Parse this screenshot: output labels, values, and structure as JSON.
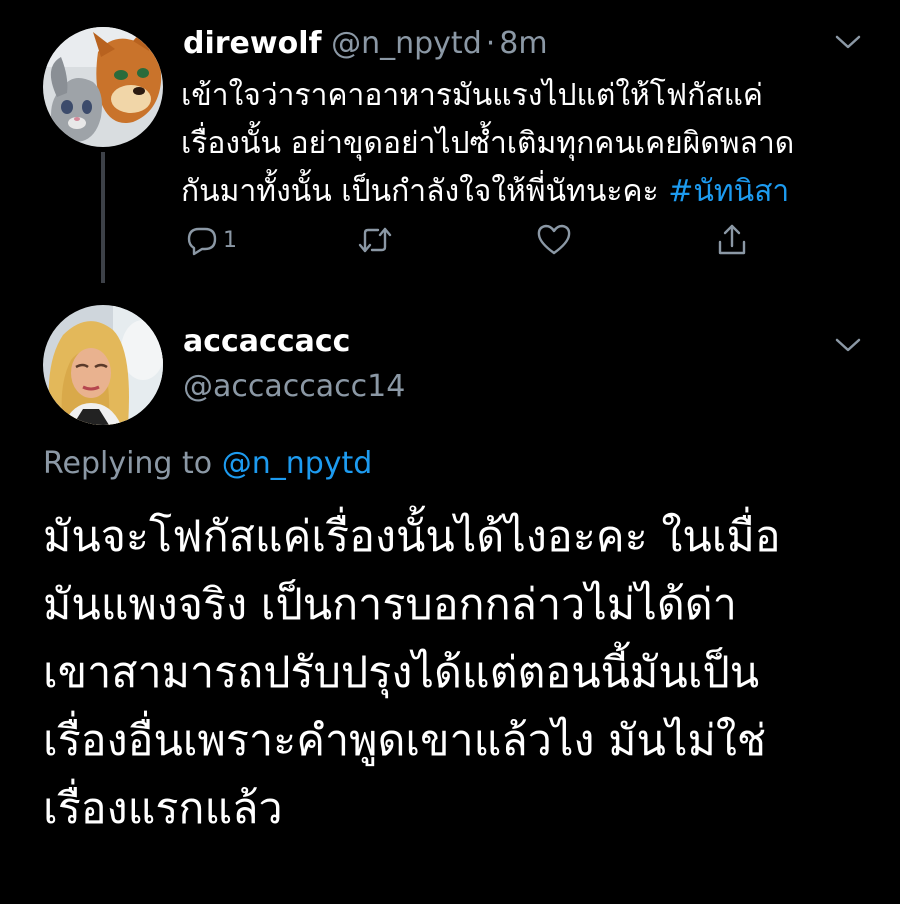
{
  "tweet1": {
    "display_name": "direwolf",
    "handle": "@n_npytd",
    "separator": "·",
    "time": "8m",
    "text_lines": [
      "เข้าใจว่าราคาอาหารมันแรงไปแต่ให้โฟกัสแค่",
      "เรื่องนั้น อย่าขุดอย่าไปซ้ำเติมทุกคนเคยผิดพลาด",
      "กันมาทั้งนั้น เป็นกำลังใจให้พี่นัทนะคะ"
    ],
    "hashtag": "#นัทนิสา",
    "reply_count": "1",
    "avatar_icon": "cartoon-characters-avatar"
  },
  "tweet2": {
    "display_name": "accaccacc",
    "handle": "@accaccacc14",
    "replying_to_label": "Replying to",
    "replying_to_handle": "@n_npytd",
    "text_lines": [
      "มันจะโฟกัสแค่เรื่องนั้นได้ไงอะคะ ในเมื่อ",
      "มันแพงจริง เป็นการบอกกล่าวไม่ได้ด่า",
      "เขาสามารถปรับปรุงได้แต่ตอนนี้มันเป็น",
      "เรื่องอื่นเพราะคำพูดเขาแล้วไง มันไม่ใช่",
      "เรื่องแรกแล้ว"
    ],
    "avatar_icon": "blonde-person-avatar"
  },
  "colors": {
    "background": "#000000",
    "text": "#ffffff",
    "secondary": "#8b98a5",
    "accent": "#1d9bf0",
    "thread_line": "#3d4148"
  }
}
